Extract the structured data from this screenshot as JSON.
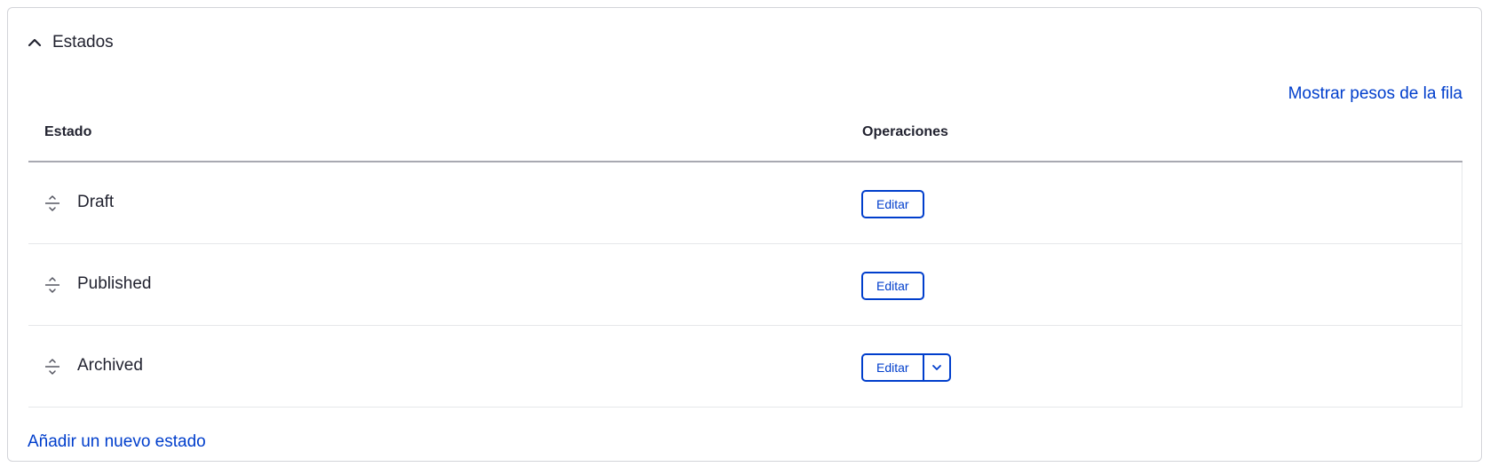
{
  "details": {
    "summary": "Estados",
    "summary_icon": "chevron-up-icon"
  },
  "table": {
    "toggle_weights_label": "Mostrar pesos de la fila",
    "headers": {
      "state": "Estado",
      "operations": "Operaciones"
    },
    "rows": [
      {
        "label": "Draft",
        "edit_label": "Editar",
        "has_dropdown": false
      },
      {
        "label": "Published",
        "edit_label": "Editar",
        "has_dropdown": false
      },
      {
        "label": "Archived",
        "edit_label": "Editar",
        "has_dropdown": true
      }
    ]
  },
  "add_state_label": "Añadir un nuevo estado",
  "colors": {
    "link": "#003ecc",
    "text": "#222330",
    "border": "#d3d4d9"
  }
}
